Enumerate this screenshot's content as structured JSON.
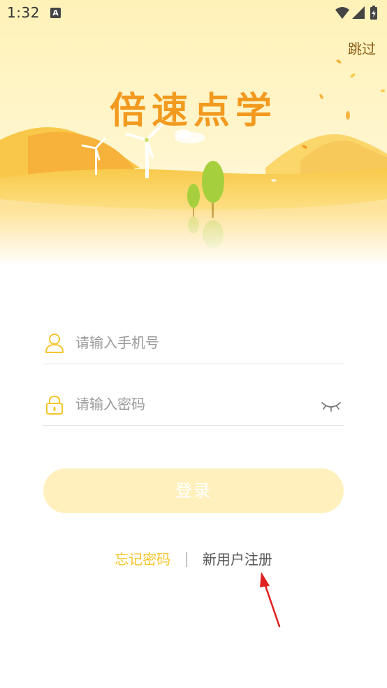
{
  "status_bar": {
    "time": "1:32",
    "notification_icon": "A"
  },
  "header": {
    "skip_label": "跳过",
    "app_title": "倍速点学"
  },
  "form": {
    "phone_placeholder": "请输入手机号",
    "phone_value": "",
    "password_placeholder": "请输入密码",
    "password_value": ""
  },
  "login_button": {
    "label": "登录"
  },
  "links": {
    "forgot_password": "忘记密码",
    "register": "新用户注册"
  },
  "colors": {
    "accent": "#f5c52c",
    "title": "#f29a1f",
    "login_button_bg": "#fff0be",
    "annotation_arrow": "#e02020"
  },
  "icons": {
    "user": "user-icon",
    "lock": "lock-icon",
    "eye": "eye-closed-icon",
    "wifi": "wifi-icon",
    "signal": "signal-icon",
    "battery": "battery-icon"
  }
}
